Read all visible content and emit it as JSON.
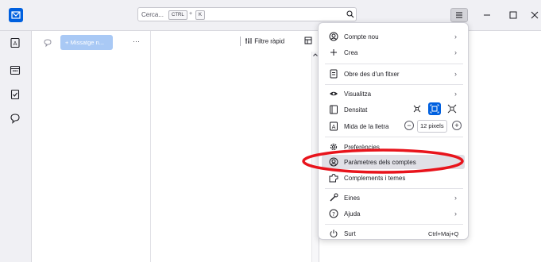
{
  "search": {
    "placeholder": "Cerca...",
    "shortcut_ctrl": "CTRL",
    "shortcut_plus": "+",
    "shortcut_key": "K"
  },
  "window_controls": {
    "minimize": "–",
    "maximize": "☐",
    "close": "✕"
  },
  "folder_pane": {
    "write_button_label": "+  Missatge n...",
    "more": "···"
  },
  "thread_pane": {
    "quick_filter_label": "Filtre ràpid"
  },
  "app_menu": {
    "items": [
      {
        "label": "Compte nou",
        "icon": "account-new-icon",
        "submenu": true
      },
      {
        "label": "Crea",
        "icon": "plus-icon",
        "submenu": true
      },
      {
        "label": "Obre des d'un fitxer",
        "icon": "file-open-icon",
        "submenu": true
      },
      {
        "label": "Visualitza",
        "icon": "eye-icon",
        "submenu": true
      },
      {
        "label": "Densitat",
        "icon": "density-icon",
        "submenu": false
      },
      {
        "label": "Mida de la lletra",
        "icon": "font-size-icon",
        "submenu": false
      },
      {
        "label": "Preferències",
        "icon": "gear-icon",
        "submenu": false
      },
      {
        "label": "Paràmetres dels comptes",
        "icon": "account-settings-icon",
        "submenu": false
      },
      {
        "label": "Complements i temes",
        "icon": "addons-icon",
        "submenu": false
      },
      {
        "label": "Eines",
        "icon": "tools-icon",
        "submenu": true
      },
      {
        "label": "Ajuda",
        "icon": "help-icon",
        "submenu": true
      },
      {
        "label": "Surt",
        "icon": "power-icon",
        "submenu": false
      }
    ],
    "font_size_value": "12 pixels",
    "quit_shortcut": "Ctrl+Maj+Q",
    "chevron": "›",
    "zoom_minus": "−",
    "zoom_plus": "+"
  },
  "colors": {
    "accent": "#0060df",
    "highlight_ellipse": "#e8141c",
    "hover_row": "#e0e0e6"
  }
}
